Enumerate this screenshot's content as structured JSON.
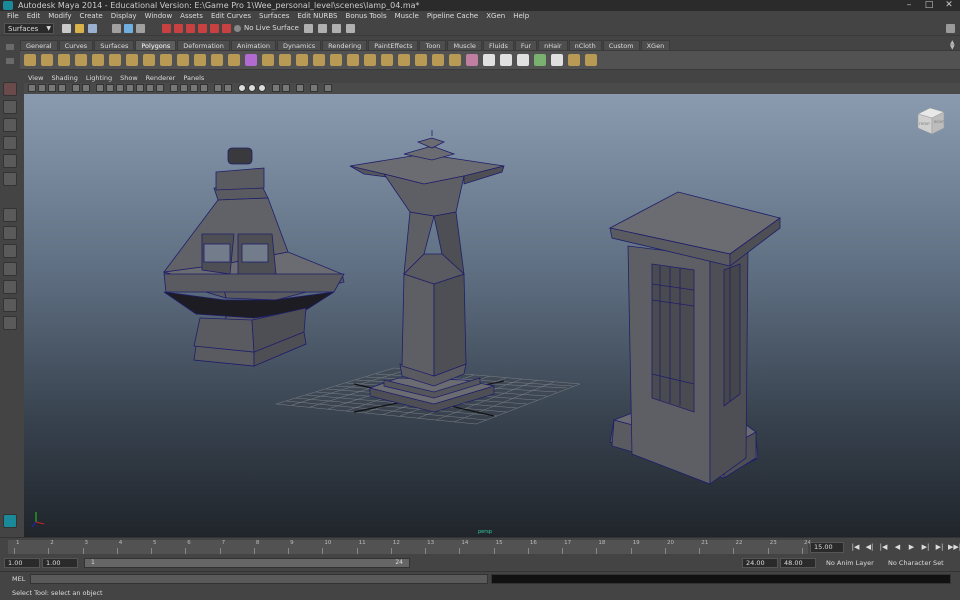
{
  "window": {
    "title": "Autodesk Maya 2014 - Educational Version: E:\\Game Pro 1\\Wee_personal_level\\scenes\\lamp_04.ma*"
  },
  "menubar": [
    "File",
    "Edit",
    "Modify",
    "Create",
    "Display",
    "Window",
    "Assets",
    "Edit Curves",
    "Surfaces",
    "Edit NURBS",
    "Bonus Tools",
    "Muscle",
    "Pipeline Cache",
    "XGen",
    "Help"
  ],
  "statusline": {
    "mode": "Surfaces",
    "live_surface": "No Live Surface"
  },
  "shelf": {
    "tabs": [
      "General",
      "Curves",
      "Surfaces",
      "Polygons",
      "Deformation",
      "Animation",
      "Dynamics",
      "Rendering",
      "PaintEffects",
      "Toon",
      "Muscle",
      "Fluids",
      "Fur",
      "nHair",
      "nCloth",
      "Custom",
      "XGen"
    ],
    "active_tab": "Polygons"
  },
  "panel": {
    "menus": [
      "View",
      "Shading",
      "Lighting",
      "Show",
      "Renderer",
      "Panels"
    ],
    "viewcube_front": "FRONT",
    "viewcube_right": "RIGHT",
    "camera_label": "persp"
  },
  "timeslider": {
    "ticks": [
      "1",
      "2",
      "3",
      "4",
      "5",
      "6",
      "7",
      "8",
      "9",
      "10",
      "11",
      "12",
      "13",
      "14",
      "15",
      "16",
      "17",
      "18",
      "19",
      "20",
      "21",
      "22",
      "23",
      "24"
    ],
    "current_frame": "15.00",
    "controls": [
      "|◀",
      "◀|",
      "|◀",
      "◀",
      "▶",
      "▶|",
      "▶|",
      "▶▶|"
    ]
  },
  "rangeslider": {
    "start_time": "1.00",
    "playback_start": "1.00",
    "range_start": "1",
    "range_end": "24",
    "playback_end": "24.00",
    "end_time": "48.00",
    "anim_layer": "No Anim Layer",
    "character_set": "No Character Set"
  },
  "cmdline": {
    "label": "MEL"
  },
  "helpline": {
    "text": "Select Tool: select an object"
  },
  "colors": {
    "viewport_top": "#8a9bb0",
    "viewport_bottom": "#20252b",
    "model_face": "#5a5b60",
    "wire": "#2a2a9a",
    "active_tab": "#5e5e5e"
  }
}
